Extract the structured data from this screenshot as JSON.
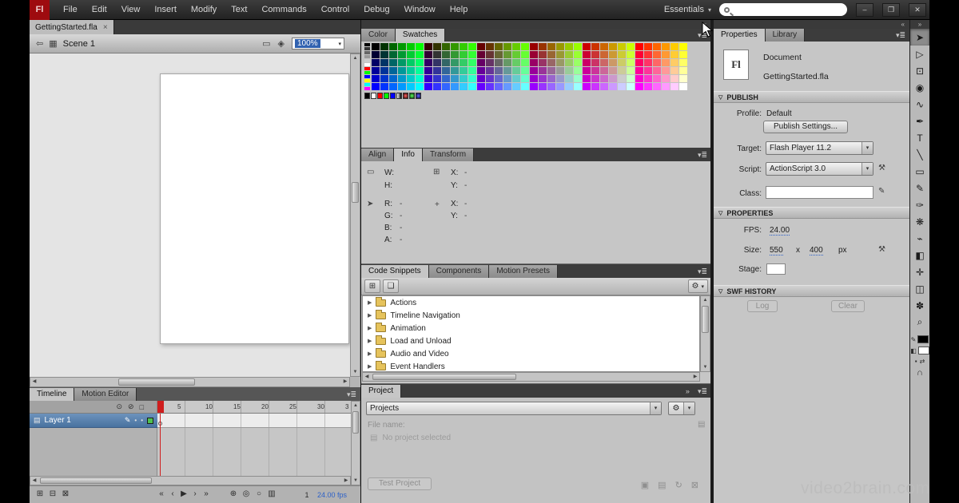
{
  "colors": {
    "accent_blue": "#2d61c8",
    "selection_blue": "#48729f",
    "playhead_red": "#cf1d1d",
    "logo_red": "#9e0b0f",
    "stage_white": "#ffffff"
  },
  "menubar": {
    "logo": "Fl",
    "items": [
      "File",
      "Edit",
      "View",
      "Insert",
      "Modify",
      "Text",
      "Commands",
      "Control",
      "Debug",
      "Window",
      "Help"
    ],
    "workspace": "Essentials",
    "search_value": ""
  },
  "window_controls": {
    "minimize": "–",
    "restore": "❐",
    "close": "✕"
  },
  "doc_tabs": {
    "active": "GettingStarted.fla",
    "close": "×"
  },
  "edit_bar": {
    "scene": "Scene 1",
    "zoom": "100%"
  },
  "swatches_panel": {
    "tabs": [
      "Color",
      "Swatches"
    ],
    "active_tab": "Swatches",
    "palette": "web-safe-216",
    "left_column": [
      "#000000",
      "#333333",
      "#666666",
      "#999999",
      "#CCCCCC",
      "#FFFFFF",
      "#FF0000",
      "#00FF00",
      "#0000FF",
      "#FFFF00",
      "#00FFFF",
      "#FF00FF"
    ],
    "bottom_row": [
      "#000000",
      "#FFFFFF",
      "#FF0000",
      "#00FF00",
      "#0000FF",
      "gradient-linear-bw",
      "gradient-radial-red",
      "gradient-radial-green",
      "gradient-radial-blue"
    ]
  },
  "info_panel": {
    "tabs": [
      "Align",
      "Info",
      "Transform"
    ],
    "active_tab": "Info",
    "w_label": "W:",
    "w_value": "",
    "h_label": "H:",
    "h_value": "",
    "x_label": "X:",
    "x_value": "-",
    "y_label": "Y:",
    "y_value": "-",
    "r_label": "R:",
    "r_value": "-",
    "g_label": "G:",
    "g_value": "-",
    "b_label": "B:",
    "b_value": "-",
    "a_label": "A:",
    "a_value": "-",
    "plus": "+",
    "x2_label": "X:",
    "x2_value": "-",
    "y2_label": "Y:",
    "y2_value": "-"
  },
  "snippets_panel": {
    "tabs": [
      "Code Snippets",
      "Components",
      "Motion Presets"
    ],
    "active_tab": "Code Snippets",
    "folders": [
      "Actions",
      "Timeline Navigation",
      "Animation",
      "Load and Unload",
      "Audio and Video",
      "Event Handlers"
    ]
  },
  "project_panel": {
    "tab": "Project",
    "dropdown_value": "Projects",
    "file_name_label": "File name:",
    "empty_message": "No project selected",
    "test_button": "Test Project"
  },
  "properties_panel": {
    "tabs": [
      "Properties",
      "Library"
    ],
    "active_tab": "Properties",
    "doc_icon": "Fl",
    "doc_type": "Document",
    "doc_name": "GettingStarted.fla",
    "publish_header": "PUBLISH",
    "profile_label": "Profile:",
    "profile_value": "Default",
    "publish_settings_button": "Publish Settings...",
    "target_label": "Target:",
    "target_value": "Flash Player 11.2",
    "script_label": "Script:",
    "script_value": "ActionScript 3.0",
    "class_label": "Class:",
    "class_value": "",
    "properties_header": "PROPERTIES",
    "fps_label": "FPS:",
    "fps_value": "24.00",
    "size_label": "Size:",
    "size_w": "550",
    "size_times": "x",
    "size_h": "400",
    "size_unit": "px",
    "stage_label": "Stage:",
    "swf_header": "SWF HISTORY",
    "log_button": "Log",
    "clear_button": "Clear"
  },
  "timeline_panel": {
    "tabs": [
      "Timeline",
      "Motion Editor"
    ],
    "active_tab": "Timeline",
    "layer_name": "Layer 1",
    "ruler_numbers": [
      "5",
      "10",
      "15",
      "20",
      "25",
      "30",
      "3"
    ],
    "current_frame": "1",
    "frame_rate": "24.00 fps"
  },
  "tools": [
    {
      "name": "selection-tool",
      "glyph": "➤",
      "selected": true
    },
    {
      "name": "subselection-tool",
      "glyph": "▷"
    },
    {
      "name": "free-transform-tool",
      "glyph": "⊡"
    },
    {
      "name": "3d-rotation-tool",
      "glyph": "◉"
    },
    {
      "name": "lasso-tool",
      "glyph": "∿"
    },
    {
      "name": "pen-tool",
      "glyph": "✒"
    },
    {
      "name": "text-tool",
      "glyph": "T"
    },
    {
      "name": "line-tool",
      "glyph": "╲"
    },
    {
      "name": "rectangle-tool",
      "glyph": "▭"
    },
    {
      "name": "pencil-tool",
      "glyph": "✎"
    },
    {
      "name": "brush-tool",
      "glyph": "✑"
    },
    {
      "name": "deco-tool",
      "glyph": "❋"
    },
    {
      "name": "bone-tool",
      "glyph": "⌁"
    },
    {
      "name": "paint-bucket-tool",
      "glyph": "◧"
    },
    {
      "name": "eyedropper-tool",
      "glyph": "✛"
    },
    {
      "name": "eraser-tool",
      "glyph": "◫"
    },
    {
      "name": "hand-tool",
      "glyph": "✽"
    },
    {
      "name": "zoom-tool",
      "glyph": "⌕"
    }
  ],
  "toolbar_colors": {
    "stroke": "#000000",
    "fill": "#ffffff"
  },
  "icons": {
    "dropdown": "▾",
    "panel_menu": "▾≣",
    "collapse_left": "«",
    "collapse_right": "»",
    "back": "⇦",
    "clapper": "▦",
    "edit_scene": "▭",
    "edit_symbols": "◈",
    "eye": "⊙",
    "lock": "⊘",
    "outline": "□",
    "layer": "▤",
    "pencil": "✎",
    "dot": "•",
    "first_frame": "«",
    "prev_frame": "‹",
    "play": "▶",
    "next_frame": "›",
    "last_frame": "»",
    "center_frame": "⊕",
    "onion_skin": "◎",
    "onion_outlines": "○",
    "edit_multiple": "▥",
    "new_layer": "⊞",
    "new_folder": "⊟",
    "delete": "⊠",
    "add": "⊞",
    "copy": "❏",
    "gear": "⚙",
    "wrench": "⚒",
    "refresh": "↻",
    "folder_plus": "▣",
    "file_plus": "▤",
    "browse": "▤",
    "disclosure": "▽",
    "triangle": "▶",
    "registration": "⊞",
    "bounds": "▭",
    "pointer": "➤",
    "plus": "+",
    "magnet": "∩",
    "swap": "⇄",
    "default_colors": "▪",
    "bucket": "◧"
  },
  "watermark": "video2brain.com"
}
